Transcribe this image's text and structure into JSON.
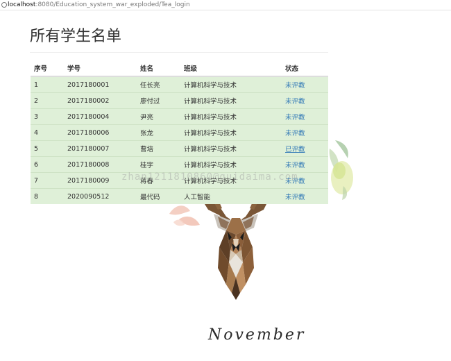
{
  "browser": {
    "url_host": "localhost",
    "url_path": ":8080/Education_system_war_exploded/Tea_login"
  },
  "page": {
    "title": "所有学生名单"
  },
  "table": {
    "headers": {
      "index": "序号",
      "student_id": "学号",
      "name": "姓名",
      "class": "班级",
      "status": "状态"
    },
    "rows": [
      {
        "index": "1",
        "student_id": "2017180001",
        "name": "任长亮",
        "class": "计算机科学与技术",
        "status": "未评教"
      },
      {
        "index": "2",
        "student_id": "2017180002",
        "name": "廖付过",
        "class": "计算机科学与技术",
        "status": "未评教"
      },
      {
        "index": "3",
        "student_id": "2017180004",
        "name": "尹亮",
        "class": "计算机科学与技术",
        "status": "未评教"
      },
      {
        "index": "4",
        "student_id": "2017180006",
        "name": "张龙",
        "class": "计算机科学与技术",
        "status": "未评教"
      },
      {
        "index": "5",
        "student_id": "2017180007",
        "name": "曹培",
        "class": "计算机科学与技术",
        "status": "已评教"
      },
      {
        "index": "6",
        "student_id": "2017180008",
        "name": "桂宇",
        "class": "计算机科学与技术",
        "status": "未评教"
      },
      {
        "index": "7",
        "student_id": "2017180009",
        "name": "蒋春",
        "class": "计算机科学与技术",
        "status": "未评教"
      },
      {
        "index": "8",
        "student_id": "2020090512",
        "name": "最代码",
        "class": "人工智能",
        "status": "未评教"
      }
    ]
  },
  "watermark": "zhan1211810860@guidaima.com",
  "decoration": {
    "month_text": "November"
  },
  "colors": {
    "row_background": "#dff0d8",
    "link": "#337ab7",
    "text": "#333333"
  },
  "icons": {
    "address_bar": "info-icon",
    "illustration": "deer-head-illustration"
  }
}
